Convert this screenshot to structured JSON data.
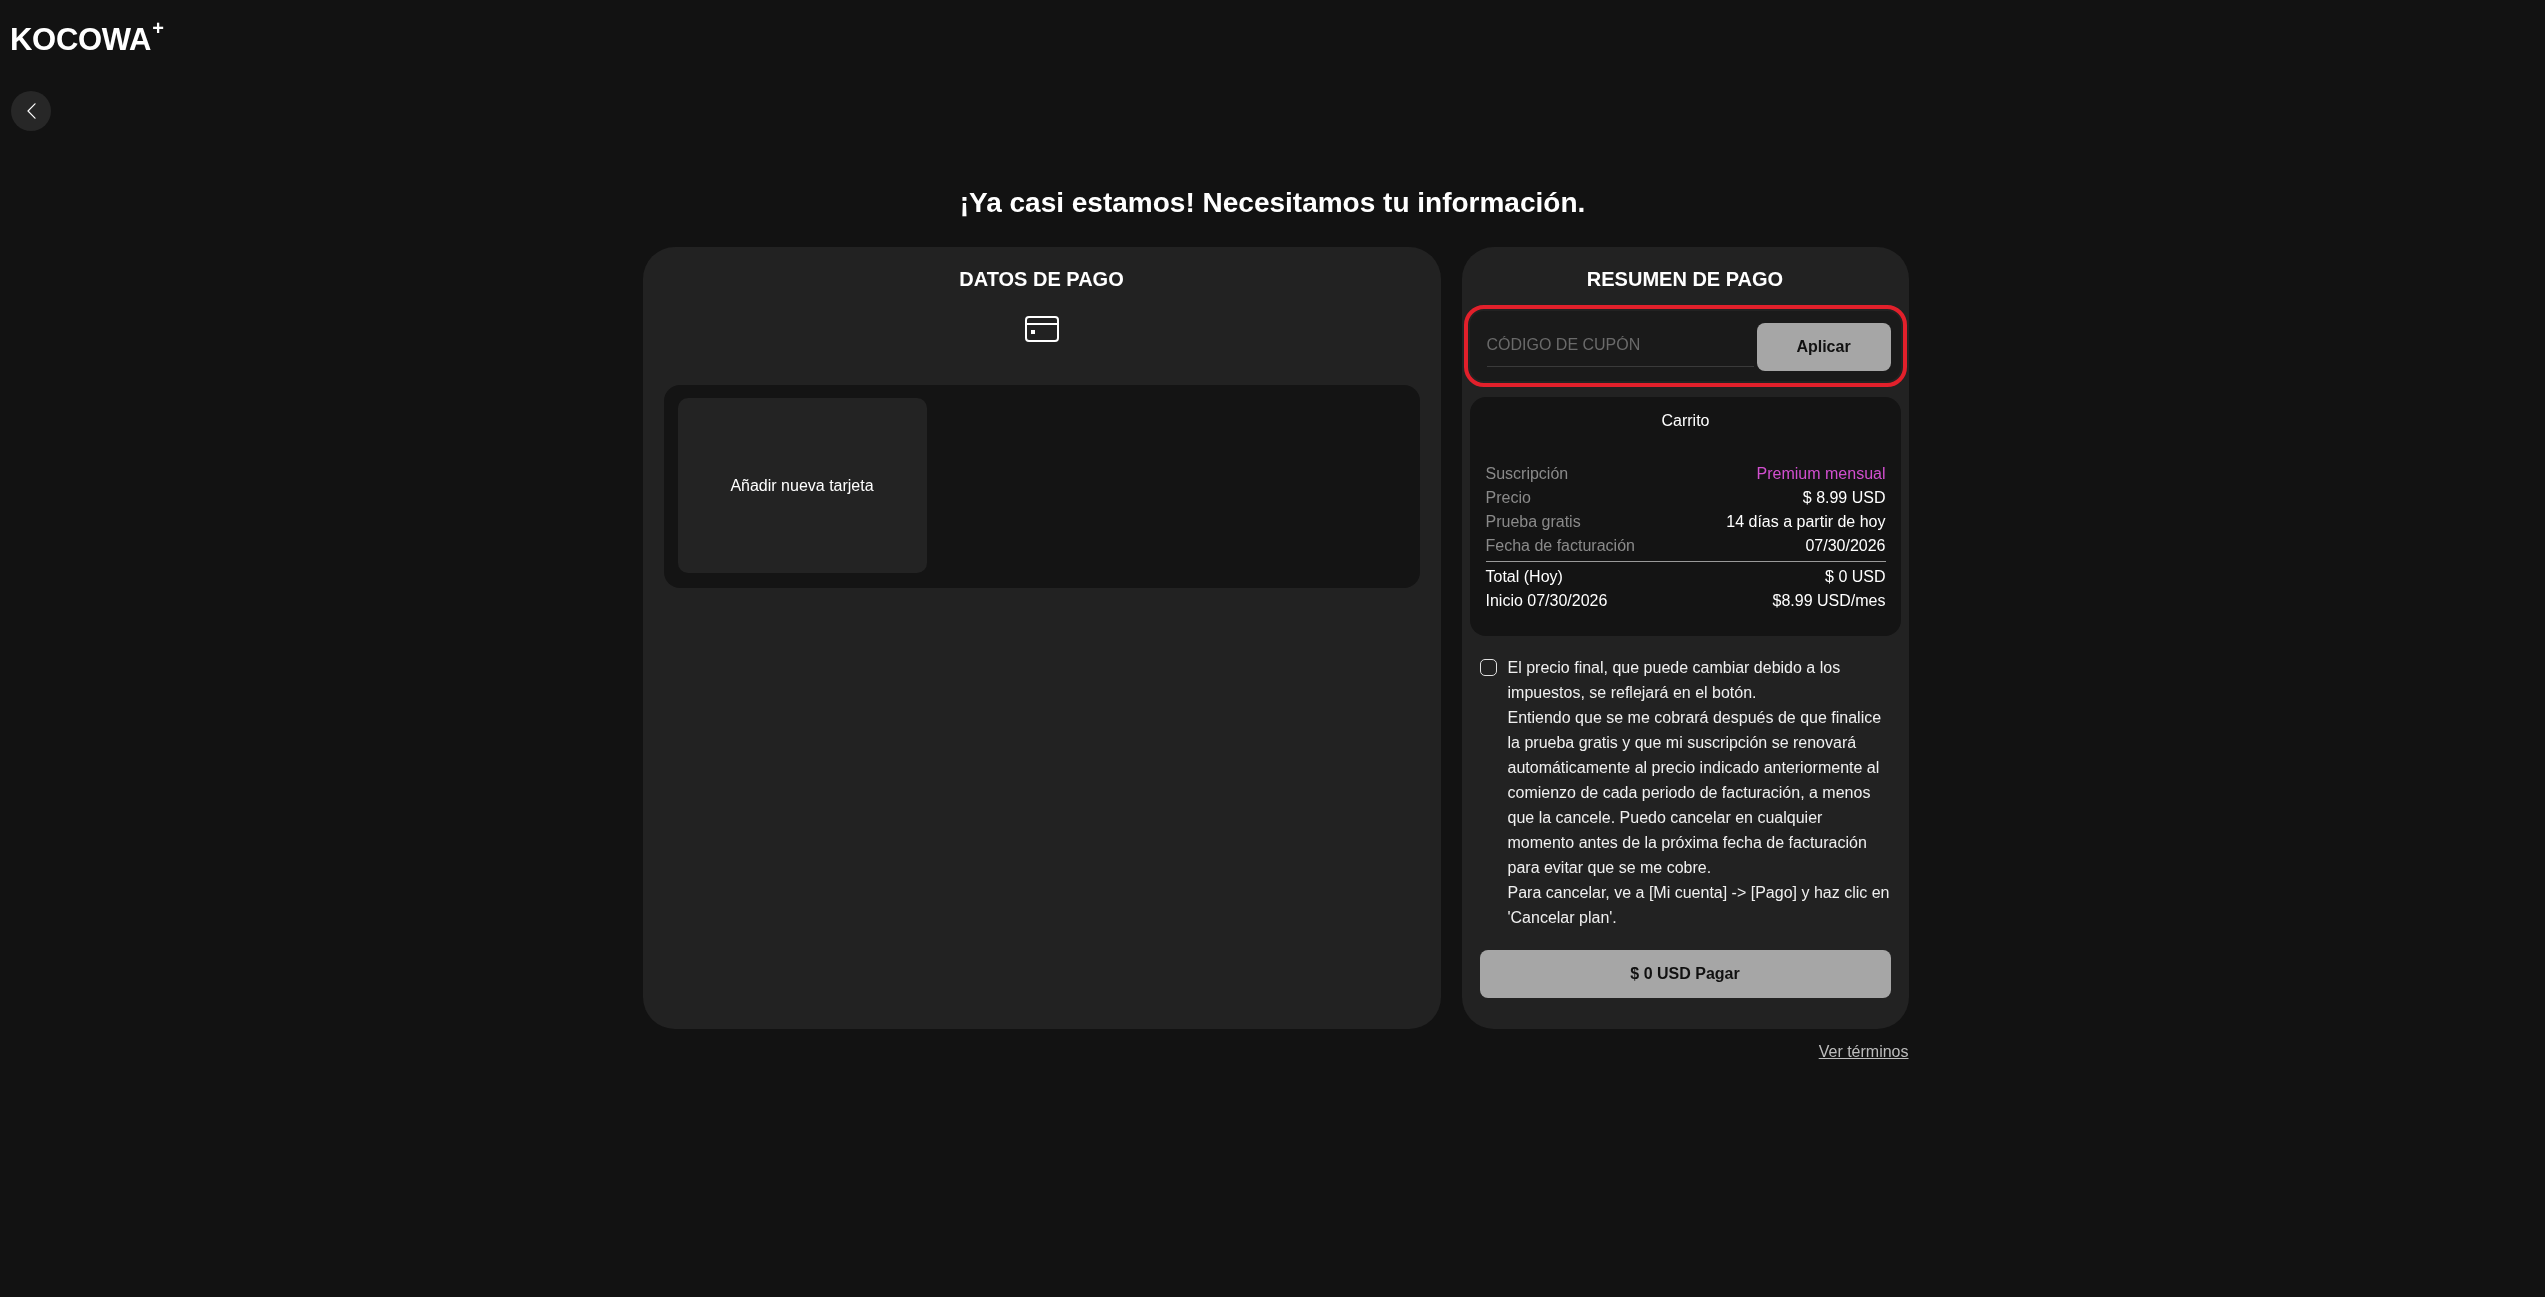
{
  "header": {
    "logo": "KOCOWA$^{+}$"
  },
  "heading": "¡Ya casi estamos! Necesitamos tu información.",
  "payment_details": {
    "title": "DATOS DE PAGO",
    "cards": [
      {
        "kind": "add",
        "label": "Añadir nueva tarjeta"
      }
    ]
  },
  "payment_summary": {
    "title": "RESUMEN DE PAGO",
    "coupon": {
      "placeholder": "CÓDIGO DE CUPÓN",
      "button": "Aplicar",
      "highlighted": true
    },
    "cart": {
      "title": "Carrito",
      "details": [
        {
          "label": "Suscripción",
          "value": "Premium mensual",
          "highlighted": true
        },
        {
          "label": "Precio",
          "value": "$ 8.99 USD",
          "highlighted": false
        },
        {
          "label": "Prueba gratis",
          "value": "14 días a partir de hoy",
          "highlighted": false
        },
        {
          "label": "Fecha de facturación",
          "value": "07/30/2026",
          "highlighted": false
        }
      ],
      "totals": [
        {
          "label": "Total (Hoy)",
          "value": "$ 0 USD"
        },
        {
          "label": "Inicio 07/30/2026",
          "value": "$8.99 USD/mes"
        }
      ]
    },
    "consent": {
      "checked": false,
      "paragraphs": [
        "El precio final, que puede cambiar debido a los impuestos, se reflejará en el botón.",
        "Entiendo que se me cobrará después de que finalice la prueba gratis y que mi suscripción se renovará automáticamente al precio indicado anteriormente al comienzo de cada periodo de facturación, a menos que la cancele. Puedo cancelar en cualquier momento antes de la próxima fecha de facturación para evitar que se me cobre.",
        "Para cancelar, ve a [Mi cuenta] -> [Pago] y haz clic en 'Cancelar plan'."
      ]
    },
    "pay_button": "$ 0 USD Pagar"
  },
  "terms_link": "Ver términos"
}
